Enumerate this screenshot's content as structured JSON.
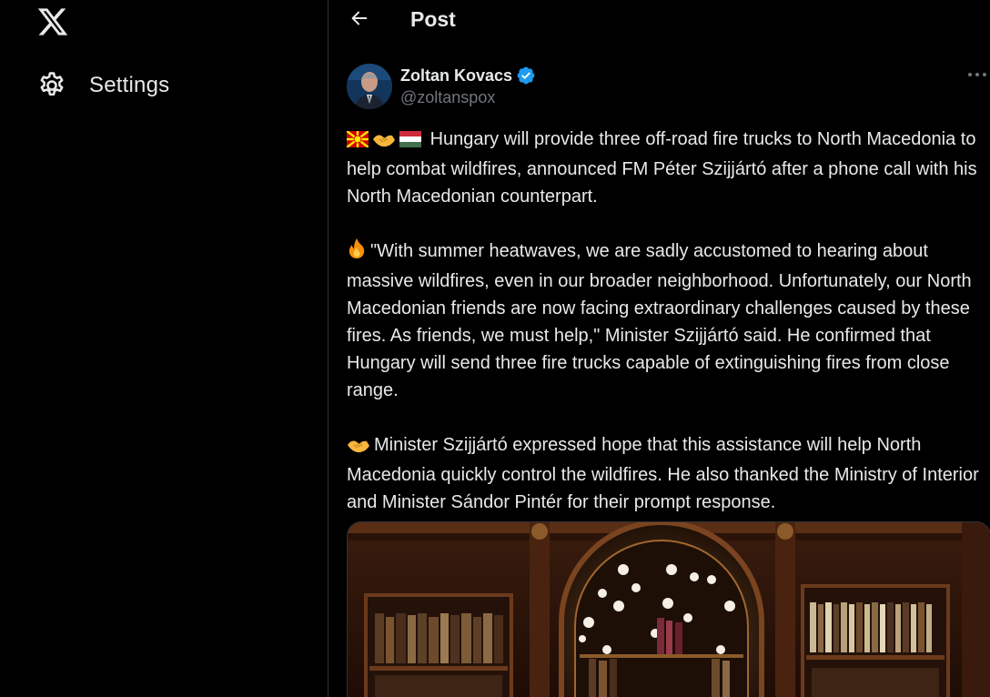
{
  "nav": {
    "logo_icon": "x-logo-icon",
    "settings_label": "Settings",
    "settings_icon": "gear-icon"
  },
  "header": {
    "title": "Post",
    "back_icon": "arrow-left-icon"
  },
  "tweet": {
    "author": {
      "name": "Zoltan Kovacs",
      "handle": "@zoltanspox",
      "verified": true
    },
    "paragraphs": [
      "Hungary will provide three off-road fire trucks to North Macedonia to help combat wildfires, announced FM Péter Szijjártó after a phone call with his North Macedonian counterpart.",
      "\"With summer heatwaves, we are sadly accustomed to hearing about massive wildfires, even in our broader neighborhood. Unfortunately, our North Macedonian friends are now facing extraordinary challenges caused by these fires. As friends, we must help,\" Minister Szijjártó said. He confirmed that Hungary will send three fire trucks capable of extinguishing fires from close range.",
      "Minister Szijjártó expressed hope that this assistance will help North Macedonia quickly control the wildfires. He also thanked the Ministry of Interior and Minister Sándor Pintér for their prompt response."
    ],
    "emojis": [
      "north-macedonia-flag",
      "handshake",
      "hungary-flag",
      "fire",
      "handshake"
    ],
    "more_icon": "more-horizontal-icon"
  },
  "colors": {
    "background": "#000000",
    "text": "#e7e9ea",
    "secondary_text": "#71767b",
    "border": "#2f3336",
    "verified_blue": "#1d9bf0"
  }
}
